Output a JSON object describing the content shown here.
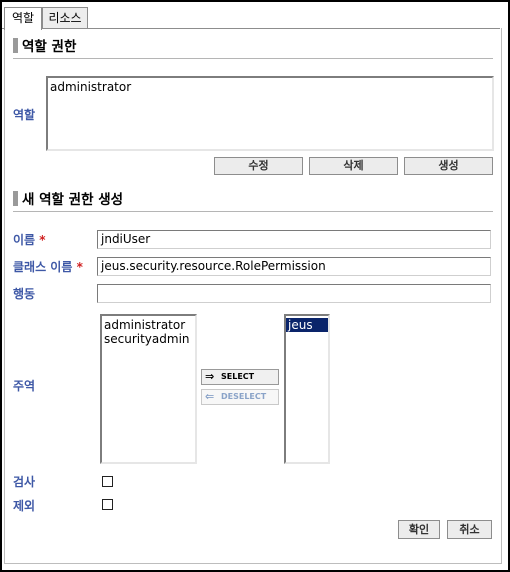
{
  "tabs": [
    {
      "label": "역할",
      "active": true
    },
    {
      "label": "리소스",
      "active": false
    }
  ],
  "role_permissions": {
    "title": "역할 권한",
    "role_label": "역할",
    "roles": [
      "administrator"
    ],
    "edit_label": "수정",
    "delete_label": "삭제",
    "create_label": "생성"
  },
  "new_permission": {
    "title": "새 역할 권한 생성",
    "name_label": "이름",
    "name_value": "jndiUser",
    "class_label": "클래스 이름",
    "class_value": "jeus.security.resource.RolePermission",
    "action_label": "행동",
    "action_value": "",
    "principal_label": "주역",
    "available_principals": [
      "administrator",
      "securityadmin"
    ],
    "selected_principals": [
      "jeus"
    ],
    "select_label": "SELECT",
    "deselect_label": "DESELECT",
    "check_label": "검사",
    "check_value": false,
    "exclude_label": "제외",
    "exclude_value": false,
    "required_mark": "*"
  },
  "footer": {
    "ok_label": "확인",
    "cancel_label": "취소"
  }
}
